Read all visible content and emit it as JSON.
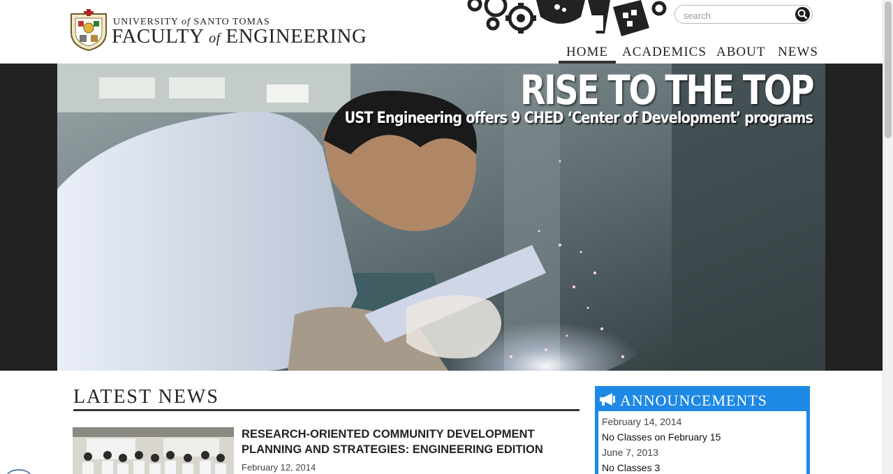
{
  "header": {
    "logo": {
      "university": "UNIVERSITY of SANTO TOMAS",
      "faculty": "FACULTY of ENGINEERING",
      "university_main": "UNIVERSITY ",
      "university_of": "of",
      "university_rest": " SANTO TOMAS",
      "faculty_main": "FACULTY ",
      "faculty_of": "of",
      "faculty_rest": " ENGINEERING"
    },
    "search": {
      "placeholder": "search"
    },
    "nav": [
      {
        "label": "HOME",
        "active": true
      },
      {
        "label": "ACADEMICS",
        "active": false
      },
      {
        "label": "ABOUT",
        "active": false
      },
      {
        "label": "NEWS",
        "active": false
      }
    ]
  },
  "hero": {
    "title": "RISE TO THE TOP",
    "subtitle": "UST Engineering offers 9 CHED ‘Center of Development’ programs"
  },
  "latest_news": {
    "heading": "LATEST NEWS",
    "items": [
      {
        "title": "RESEARCH-ORIENTED COMMUNITY DEVELOPMENT PLANNING AND STRATEGIES: ENGINEERING EDITION",
        "date": "February 12, 2014"
      }
    ]
  },
  "announcements": {
    "heading": "ANNOUNCEMENTS",
    "items": [
      {
        "date": "February 14, 2014",
        "text": "No Classes on February 15"
      },
      {
        "date": "June 7, 2013",
        "text": "No Classes 3"
      }
    ]
  },
  "colors": {
    "announcement_blue": "#1e88e5",
    "header_text": "#222222",
    "hero_band": "#222222"
  },
  "icons": [
    "gears-decoration-icon",
    "search-icon",
    "megaphone-icon",
    "university-seal-logo"
  ]
}
